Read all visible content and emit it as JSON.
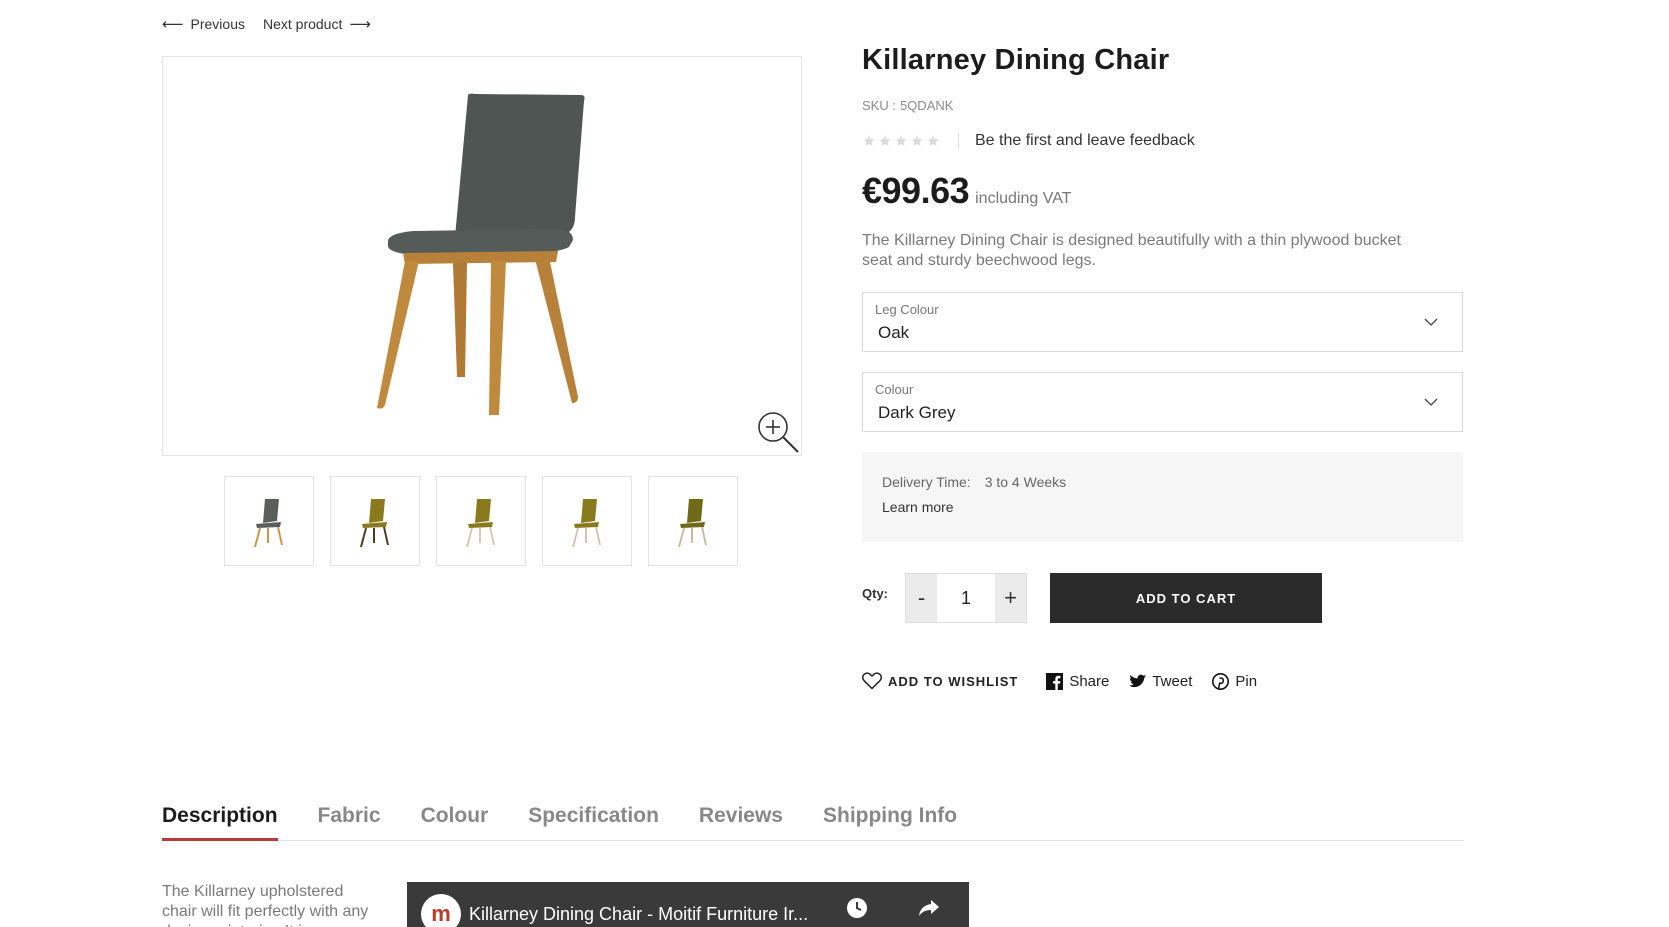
{
  "nav": {
    "previous_label": "Previous",
    "next_label": "Next product"
  },
  "product": {
    "title": "Killarney Dining Chair",
    "sku_label": "SKU :",
    "sku_value": "5QDANK",
    "rating_stars": 0,
    "rating_max": 5,
    "feedback_label": "Be the first and leave feedback",
    "price": "€99.63",
    "vat_label": "including VAT",
    "short_description": "The Killarney Dining Chair is designed beautifully with a thin plywood bucket seat and sturdy beechwood legs."
  },
  "options": {
    "leg_colour": {
      "label": "Leg Colour",
      "value": "Oak"
    },
    "colour": {
      "label": "Colour",
      "value": "Dark Grey"
    }
  },
  "delivery": {
    "label": "Delivery Time:",
    "value": "3 to 4 Weeks",
    "learn_more": "Learn more"
  },
  "purchase": {
    "qty_label": "Qty:",
    "qty_value": "1",
    "minus": "-",
    "plus": "+",
    "add_to_cart": "ADD TO CART"
  },
  "social": {
    "wishlist": "ADD TO WISHLIST",
    "share": "Share",
    "tweet": "Tweet",
    "pin": "Pin"
  },
  "tabs": [
    {
      "label": "Description",
      "active": true
    },
    {
      "label": "Fabric",
      "active": false
    },
    {
      "label": "Colour",
      "active": false
    },
    {
      "label": "Specification",
      "active": false
    },
    {
      "label": "Reviews",
      "active": false
    },
    {
      "label": "Shipping Info",
      "active": false
    }
  ],
  "description_body": "The Killarney upholstered chair will fit perfectly with any designer interior. It is",
  "video": {
    "title": "Killarney Dining Chair - Moitif Furniture Ir...",
    "logo_letter": "m"
  },
  "thumbnails": [
    {
      "seat_color": "#5b5f5c",
      "leg_color": "#c8964f"
    },
    {
      "seat_color": "#8a7a1e",
      "leg_color": "#4a3a22"
    },
    {
      "seat_color": "#8a7a1e",
      "leg_color": "#d4c9b5"
    },
    {
      "seat_color": "#8a7a1e",
      "leg_color": "#cfc6b4"
    },
    {
      "seat_color": "#6e6a18",
      "leg_color": "#c9bca2"
    }
  ],
  "colors": {
    "seat_main": "#4f5552",
    "legs_main": "#c08a3e",
    "tab_underline": "#b83a3a",
    "cart_bg": "#2b2b2b"
  },
  "icons": [
    "arrow-left-icon",
    "arrow-right-icon",
    "zoom-in-icon",
    "chevron-down-icon",
    "star-icon",
    "heart-icon",
    "facebook-icon",
    "twitter-icon",
    "pinterest-icon",
    "clock-icon",
    "share-icon"
  ]
}
